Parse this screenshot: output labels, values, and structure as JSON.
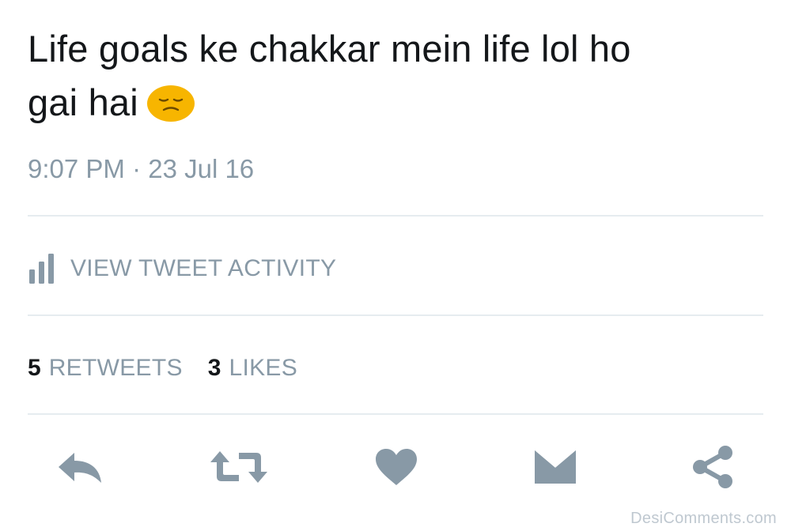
{
  "tweet": {
    "text_line1": "Life goals ke chakkar mein life lol ho",
    "text_line2": "gai hai",
    "emoji": "pensive-face-emoji",
    "timestamp": "9:07 PM · 23 Jul 16"
  },
  "activity": {
    "icon": "bar-chart-icon",
    "label": "VIEW TWEET ACTIVITY"
  },
  "stats": {
    "retweets_count": "5",
    "retweets_label": "RETWEETS",
    "likes_count": "3",
    "likes_label": "LIKES"
  },
  "actions": {
    "reply_icon": "reply-icon",
    "retweet_icon": "retweet-icon",
    "like_icon": "heart-icon",
    "dm_icon": "envelope-icon",
    "share_icon": "share-icon"
  },
  "colors": {
    "text_primary": "#14171a",
    "text_secondary": "#8899a6",
    "icon_gray": "#8899a6",
    "divider": "#e6ecf0",
    "emoji_yellow": "#f7b500"
  },
  "watermark": "DesiComments.com"
}
